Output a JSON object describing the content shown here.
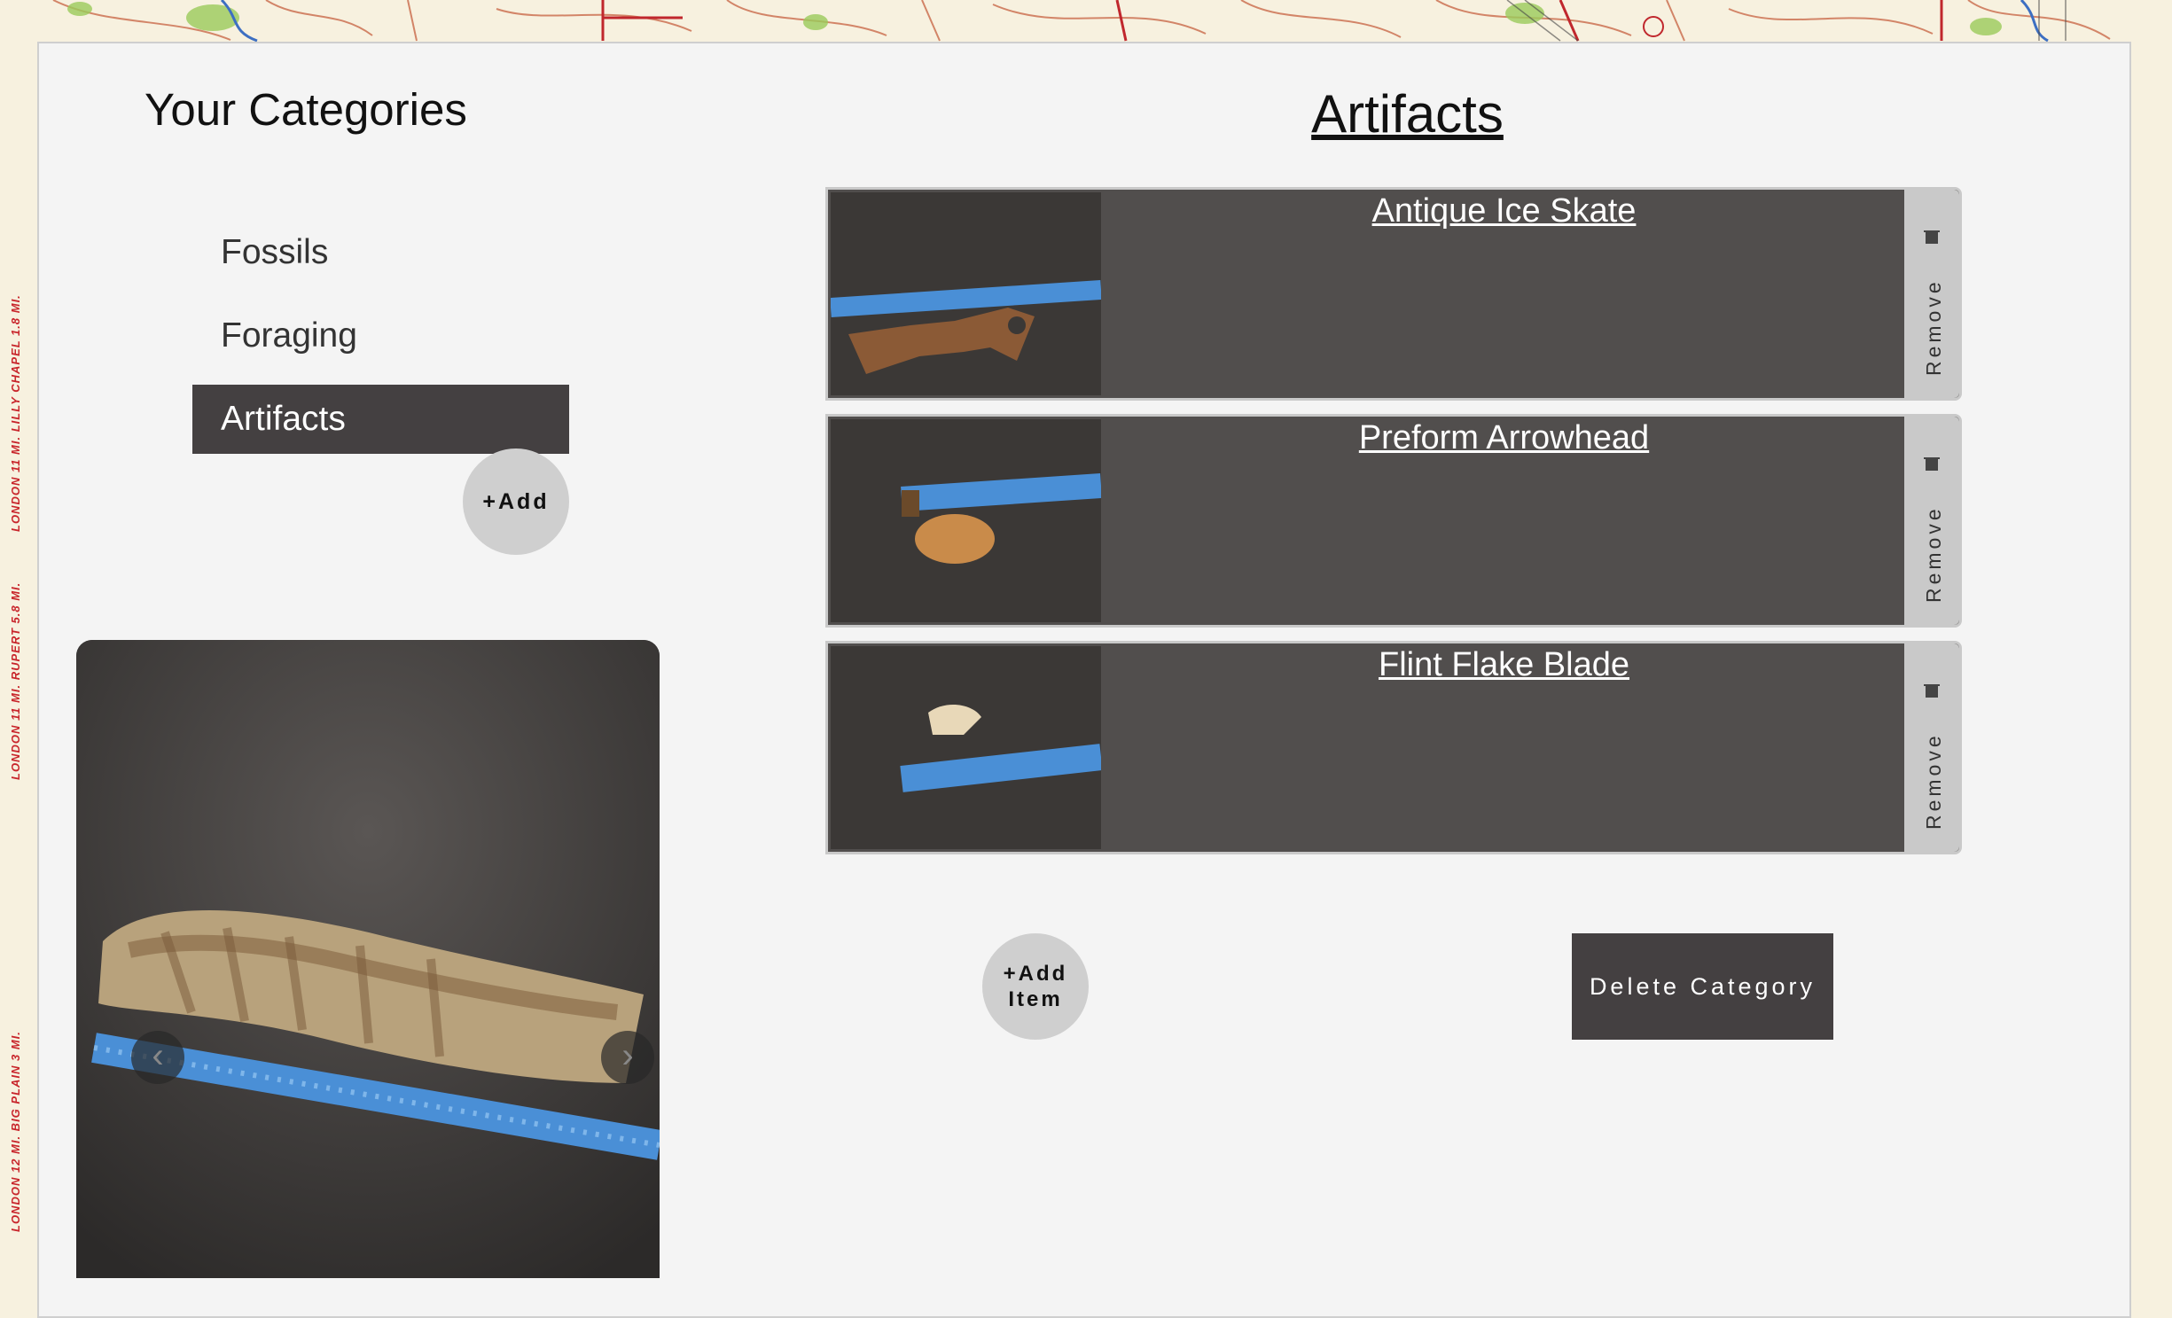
{
  "sidebar": {
    "title": "Your Categories",
    "categories": [
      {
        "label": "Fossils",
        "active": false
      },
      {
        "label": "Foraging",
        "active": false
      },
      {
        "label": "Artifacts",
        "active": true
      }
    ],
    "add_label": "+Add"
  },
  "map_labels": [
    "LONDON 11 MI. LILLY CHAPEL 1.8 MI.",
    "LONDON 11 MI. RUPERT 5.8 MI.",
    "LONDON 12 MI. BIG PLAIN 3 MI."
  ],
  "main": {
    "title": "Artifacts",
    "items": [
      {
        "title": "Antique Ice Skate",
        "remove_label": "Remove"
      },
      {
        "title": "Preform Arrowhead",
        "remove_label": "Remove"
      },
      {
        "title": "Flint Flake Blade",
        "remove_label": "Remove"
      }
    ],
    "add_item_label_line1": "+Add",
    "add_item_label_line2": "Item",
    "delete_label": "Delete Category"
  },
  "viewer": {
    "prev_icon": "chevron-left-icon",
    "next_icon": "chevron-right-icon"
  },
  "colors": {
    "panel_bg": "#f4f4f4",
    "active_category": "#444041",
    "item_row": "#514e4d",
    "button_grey": "#cfcfcf"
  }
}
